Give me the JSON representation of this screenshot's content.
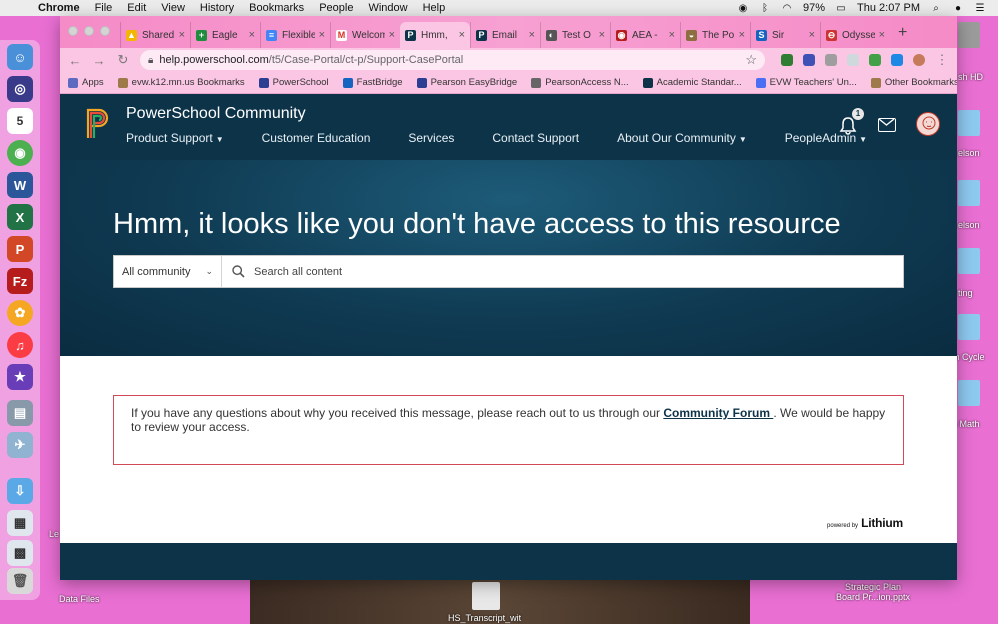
{
  "menubar": {
    "app": "Chrome",
    "items": [
      "File",
      "Edit",
      "View",
      "History",
      "Bookmarks",
      "People",
      "Window",
      "Help"
    ],
    "battery": "97%",
    "clock": "Thu 2:07 PM"
  },
  "desktop": {
    "labels": {
      "hd": "sh HD",
      "nelson1": "elson",
      "nelson2": "elson",
      "ting": "ting",
      "cycle": "m Cycle",
      "math": "n Math",
      "strategic": "Strategic Plan",
      "board": "Board Pr...ion.pptx",
      "datafiles": "Data Files",
      "transcript": "HS_Transcript_wit",
      "le": "Le"
    }
  },
  "tabs": [
    {
      "label": "Shared",
      "color": "#f2b600",
      "glyph": "▲"
    },
    {
      "label": "Eagle",
      "color": "#1e8e3e",
      "glyph": "+"
    },
    {
      "label": "Flexible",
      "color": "#4285f4",
      "glyph": "≡"
    },
    {
      "label": "Welcome",
      "color": "#ffffff",
      "glyph": "M"
    },
    {
      "label": "Hmm,",
      "color": "#0d3349",
      "glyph": "P",
      "active": true
    },
    {
      "label": "Email",
      "color": "#0d3349",
      "glyph": "P"
    },
    {
      "label": "Test O",
      "color": "#555555",
      "glyph": "◐"
    },
    {
      "label": "AEA -",
      "color": "#b71c1c",
      "glyph": "◉"
    },
    {
      "label": "The Po",
      "color": "#8d6e3f",
      "glyph": "◒"
    },
    {
      "label": "Sir",
      "color": "#1565c0",
      "glyph": "S"
    },
    {
      "label": "Odyssey",
      "color": "#cc3333",
      "glyph": "⊖"
    }
  ],
  "url": {
    "domain": "help.powerschool.com",
    "path": "/t5/Case-Portal/ct-p/Support-CasePortal"
  },
  "bookmarks": [
    {
      "label": "Apps",
      "color": "#5c6bc0"
    },
    {
      "label": "evw.k12.mn.us Bookmarks",
      "color": "#9e7a4a"
    },
    {
      "label": "PowerSchool",
      "color": "#2c3e91"
    },
    {
      "label": "FastBridge",
      "color": "#1565c0"
    },
    {
      "label": "Pearson EasyBridge",
      "color": "#2c3e91"
    },
    {
      "label": "PearsonAccess N...",
      "color": "#666666"
    },
    {
      "label": "Academic Standar...",
      "color": "#0d3349"
    },
    {
      "label": "EVW Teachers' Un...",
      "color": "#4c6ef5"
    },
    {
      "label": "Other Bookmarks",
      "color": "#9e7a4a"
    }
  ],
  "site": {
    "title": "PowerSchool Community",
    "nav": [
      {
        "label": "Product Support",
        "dropdown": true
      },
      {
        "label": "Customer Education",
        "dropdown": false
      },
      {
        "label": "Services",
        "dropdown": false
      },
      {
        "label": "Contact Support",
        "dropdown": false
      },
      {
        "label": "About Our Community",
        "dropdown": true
      },
      {
        "label": "PeopleAdmin",
        "dropdown": true
      }
    ],
    "notification_count": "1"
  },
  "hero": {
    "title": "Hmm, it looks like you don't have access to this resource",
    "scope": "All community",
    "search_placeholder": "Search all content"
  },
  "notice": {
    "text_before": "If you have any questions about why you received this message, please reach out to us through our ",
    "link": "Community Forum ",
    "text_after": ". We would be happy to review your access."
  },
  "footer": {
    "powered_by": "powered by",
    "brand": "Lithium"
  }
}
